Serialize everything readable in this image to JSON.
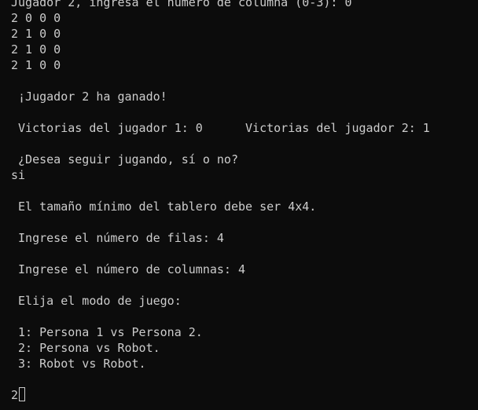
{
  "terminal": {
    "background": "#0c0c0c",
    "foreground": "#cccccc",
    "lines": {
      "l0": "Jugador 2, ingresa el número de columna (0-3): 0",
      "l1": "2 0 0 0",
      "l2": "2 1 0 0",
      "l3": "2 1 0 0",
      "l4": "2 1 0 0",
      "l5": " ¡Jugador 2 ha ganado!",
      "l6": " Victorias del jugador 1: 0      Victorias del jugador 2: 1",
      "l7": " ¿Desea seguir jugando, sí o no?",
      "l8": "si",
      "l9": " El tamaño mínimo del tablero debe ser 4x4.",
      "l10": " Ingrese el número de filas: 4",
      "l11": " Ingrese el número de columnas: 4",
      "l12": " Elija el modo de juego:",
      "l13": " 1: Persona 1 vs Persona 2.",
      "l14": " 2: Persona vs Robot.",
      "l15": " 3: Robot vs Robot.",
      "l16": "2"
    }
  }
}
